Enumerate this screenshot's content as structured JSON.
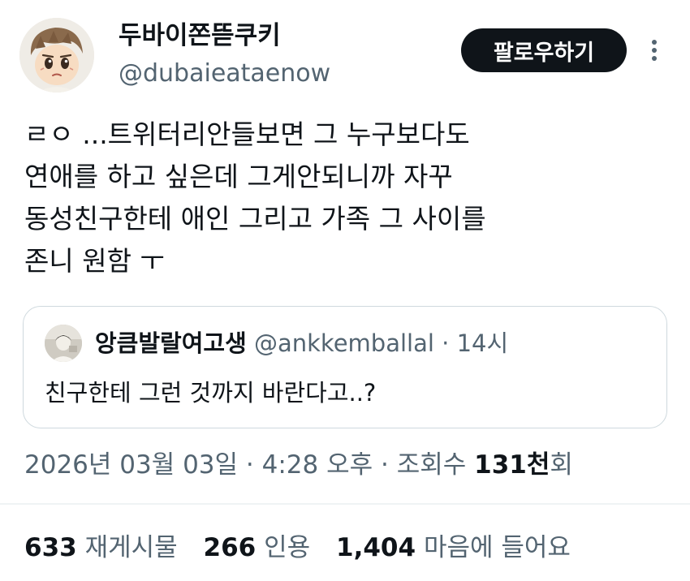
{
  "author": {
    "display_name": "두바이쫀뜯쿠키",
    "handle": "@dubaieataenow",
    "avatar_icon": "cartoon-avatar-icon"
  },
  "follow_button_label": "팔로우하기",
  "more_icon": "more-vertical-icon",
  "tweet": {
    "lines": [
      "ㄹㅇ ...트위터리안들보면 그 누구보다도",
      "연애를 하고 싶은데 그게안되니까 자꾸",
      "동성친구한테 애인 그리고 가족 그 사이를",
      "존니 원함 ㅜ"
    ]
  },
  "quote": {
    "display_name": "앙큼발랄여고생",
    "handle": "@ankkemballal",
    "separator": "·",
    "time": "14시",
    "text": "친구한테 그런 것까지 바란다고..?",
    "avatar_icon": "photo-avatar-icon"
  },
  "meta": {
    "date": "2026년 03월 03일",
    "separator1": "·",
    "time": "4:28 오후",
    "separator2": "·",
    "views_label_prefix": "조회수",
    "views_count": "131천",
    "views_label_suffix": "회"
  },
  "stats": [
    {
      "count": "633",
      "label": "재게시물"
    },
    {
      "count": "266",
      "label": "인용"
    },
    {
      "count": "1,404",
      "label": "마음에 들어요"
    }
  ]
}
